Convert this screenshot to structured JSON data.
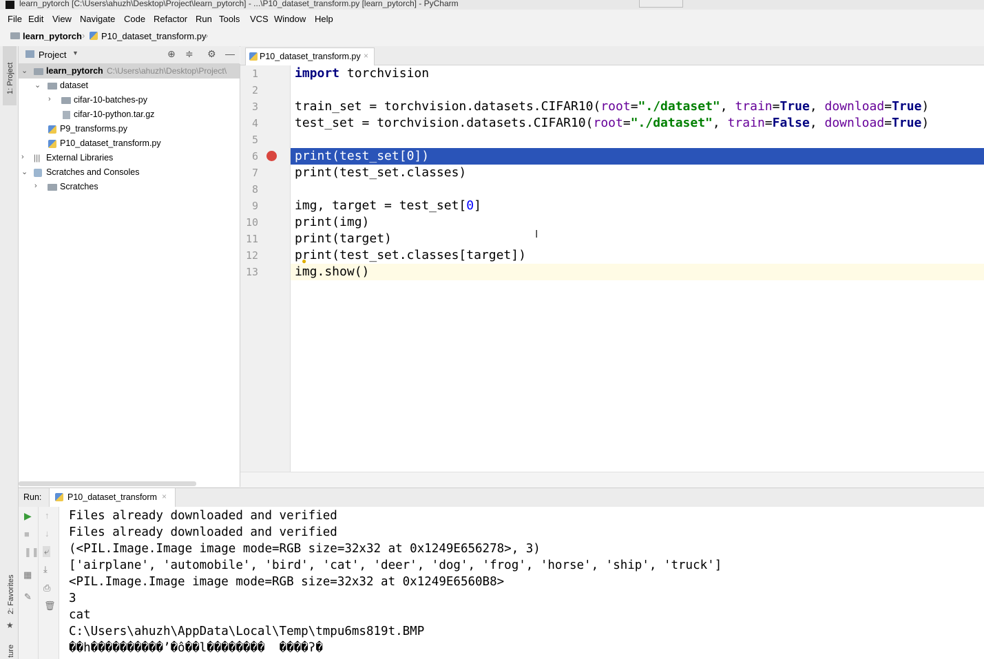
{
  "window": {
    "title": "learn_pytorch [C:\\Users\\ahuzh\\Desktop\\Project\\learn_pytorch] - ...\\P10_dataset_transform.py [learn_pytorch] - PyCharm"
  },
  "menu": [
    "File",
    "Edit",
    "View",
    "Navigate",
    "Code",
    "Refactor",
    "Run",
    "Tools",
    "VCS",
    "Window",
    "Help"
  ],
  "breadcrumb": {
    "project": "learn_pytorch",
    "file": "P10_dataset_transform.py"
  },
  "side_tabs": {
    "project": "1: Project",
    "favorites": "2: Favorites",
    "structure": "ture"
  },
  "project_panel": {
    "header": "Project",
    "root": {
      "name": "learn_pytorch",
      "path": "C:\\Users\\ahuzh\\Desktop\\Project\\"
    },
    "items": [
      {
        "label": "dataset"
      },
      {
        "label": "cifar-10-batches-py"
      },
      {
        "label": "cifar-10-python.tar.gz"
      },
      {
        "label": "P9_transforms.py"
      },
      {
        "label": "P10_dataset_transform.py"
      },
      {
        "label": "External Libraries"
      },
      {
        "label": "Scratches and Consoles"
      },
      {
        "label": "Scratches"
      }
    ]
  },
  "editor": {
    "tab": "P10_dataset_transform.py",
    "line_numbers": [
      "1",
      "2",
      "3",
      "4",
      "5",
      "6",
      "7",
      "8",
      "9",
      "10",
      "11",
      "12",
      "13"
    ],
    "lines": {
      "l1": {
        "kw": "import",
        "rest": " torchvision"
      },
      "l3": {
        "a": "train_set = torchvision.datasets.CIFAR10(",
        "p1": "root",
        "eq1": "=",
        "s1": "\"./dataset\"",
        "c1": ", ",
        "p2": "train",
        "eq2": "=",
        "v2": "True",
        "c2": ", ",
        "p3": "download",
        "eq3": "=",
        "v3": "True",
        "end": ")"
      },
      "l4": {
        "a": "test_set = torchvision.datasets.CIFAR10(",
        "p1": "root",
        "eq1": "=",
        "s1": "\"./dataset\"",
        "c1": ", ",
        "p2": "train",
        "eq2": "=",
        "v2": "False",
        "c2": ", ",
        "p3": "download",
        "eq3": "=",
        "v3": "True",
        "end": ")"
      },
      "l6": {
        "a": "print(test_set[",
        "n": "0",
        "end": "])"
      },
      "l7": "print(test_set.classes)",
      "l9": {
        "a": "img, target = test_set[",
        "n": "0",
        "end": "]"
      },
      "l10": "print(img)",
      "l11": "print(target)",
      "l12": "print(test_set.classes[target])",
      "l13": "img.show()"
    }
  },
  "run_panel": {
    "label": "Run:",
    "tab": "P10_dataset_transform",
    "output": [
      "Files already downloaded and verified",
      "Files already downloaded and verified",
      "(<PIL.Image.Image image mode=RGB size=32x32 at 0x1249E656278>, 3)",
      "['airplane', 'automobile', 'bird', 'cat', 'deer', 'dog', 'frog', 'horse', 'ship', 'truck']",
      "<PIL.Image.Image image mode=RGB size=32x32 at 0x1249E6560B8>",
      "3",
      "cat",
      "C:\\Users\\ahuzh\\AppData\\Local\\Temp\\tmpu6ms819t.BMP",
      "��h����������’�ô��l��������  ����ʔ�"
    ]
  },
  "colors": {
    "selection": "#2a54b8",
    "breakpoint": "#d9463f",
    "keyword": "#000080",
    "string": "#008000",
    "param": "#660099"
  }
}
